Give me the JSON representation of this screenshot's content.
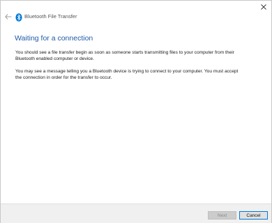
{
  "window": {
    "title": "Bluetooth File Transfer"
  },
  "icons": {
    "back": "back-arrow-icon",
    "bluetooth": "bluetooth-icon",
    "close": "close-icon"
  },
  "main": {
    "heading": "Waiting for a connection",
    "paragraph1": "You should see a file transfer begin as soon as someone starts transmitting files to your computer from their Bluetooth enabled computer or device.",
    "paragraph2": "You may see a message telling you a Bluetooth device is trying to connect to your computer. You must accept the connection in order for the transfer to occur."
  },
  "footer": {
    "next_label": "Next",
    "next_enabled": false,
    "cancel_label": "Cancel"
  },
  "colors": {
    "heading": "#1e5aa8",
    "bluetooth": "#0078d7",
    "focus_border": "#0078d7"
  }
}
